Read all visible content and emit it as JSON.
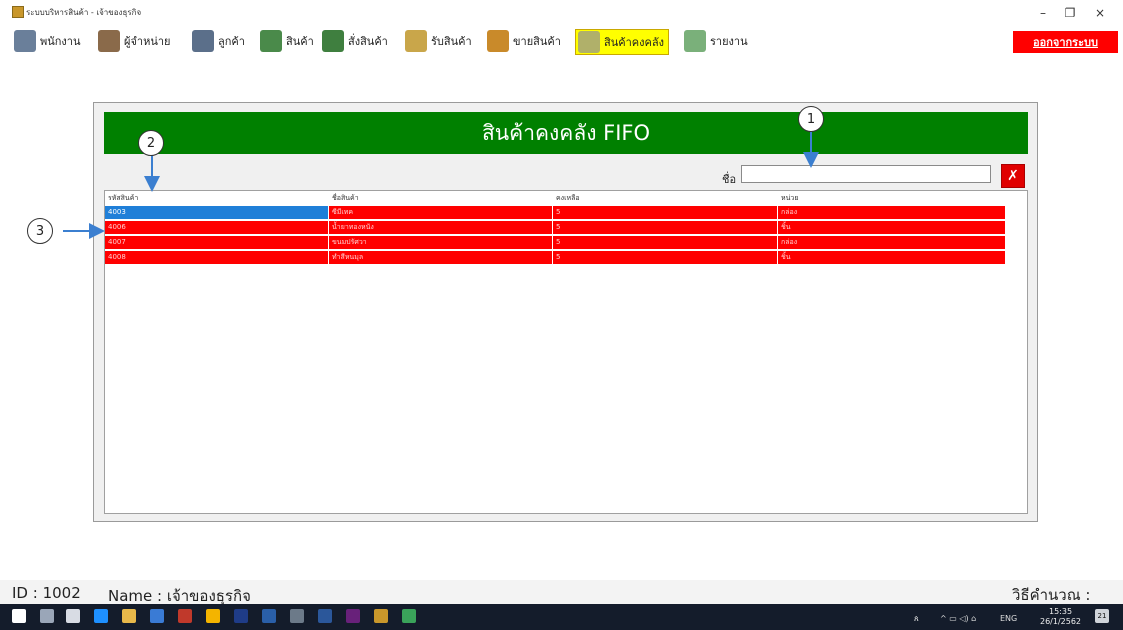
{
  "window": {
    "title": "ระบบบริหารสินค้า - เจ้าของธุรกิจ",
    "minimize_glyph": "–",
    "restore_glyph": "❐",
    "close_glyph": "×"
  },
  "menu": {
    "items": [
      {
        "label": "พนักงาน",
        "icon": "employee-icon",
        "color": "#6a7f9a"
      },
      {
        "label": "ผู้จำหน่าย",
        "icon": "supplier-icon",
        "color": "#8a6a4a"
      },
      {
        "label": "ลูกค้า",
        "icon": "customer-icon",
        "color": "#5b6f8a"
      },
      {
        "label": "สินค้า",
        "icon": "products-icon",
        "color": "#4a8a4a"
      },
      {
        "label": "สั่งสินค้า",
        "icon": "order-icon",
        "color": "#3f7f3f"
      },
      {
        "label": "รับสินค้า",
        "icon": "receive-icon",
        "color": "#c9a64a"
      },
      {
        "label": "ขายสินค้า",
        "icon": "sell-icon",
        "color": "#c98a2a"
      },
      {
        "label": "สินค้าคงคลัง",
        "icon": "inventory-icon",
        "color": "#b0b06a"
      },
      {
        "label": "รายงาน",
        "icon": "report-icon",
        "color": "#7ab07a"
      }
    ],
    "active_item": "สินค้าคงคลัง",
    "logout_label": "ออกจากระบบ"
  },
  "panel": {
    "header_title": "สินค้าคงคลัง FIFO",
    "search_label": "ชื่อ",
    "search_value": "",
    "clear_glyph": "✗"
  },
  "table": {
    "columns": [
      "รหัสสินค้า",
      "ชื่อสินค้า",
      "คงเหลือ",
      "หน่วย"
    ],
    "rows": [
      [
        "4003",
        "ซีมีเทค",
        "5",
        "กล่อง"
      ],
      [
        "4006",
        "น้ำยาทองหนัง",
        "5",
        "ชิ้น"
      ],
      [
        "4007",
        "ขนมปรัศวา",
        "5",
        "กล่อง"
      ],
      [
        "4008",
        "ทำสีหนมุล",
        "5",
        "ชิ้น"
      ]
    ],
    "selected_row": 0
  },
  "callouts": [
    "1",
    "2",
    "3"
  ],
  "status": {
    "id_text": "ID :  1002",
    "name_text": "Name :  เจ้าของธุรกิจ",
    "method_text": "วิธีคำนวณ : FIFO"
  },
  "taskbar": {
    "lang": "ENG",
    "time": "15:35",
    "date": "26/1/2562",
    "notification_count": "21"
  },
  "colors": {
    "header_green": "#008000",
    "row_red": "#ff0000",
    "selected_blue": "#1f7fd8",
    "logout_red": "#ff0000",
    "active_menu": "#ffff00"
  }
}
